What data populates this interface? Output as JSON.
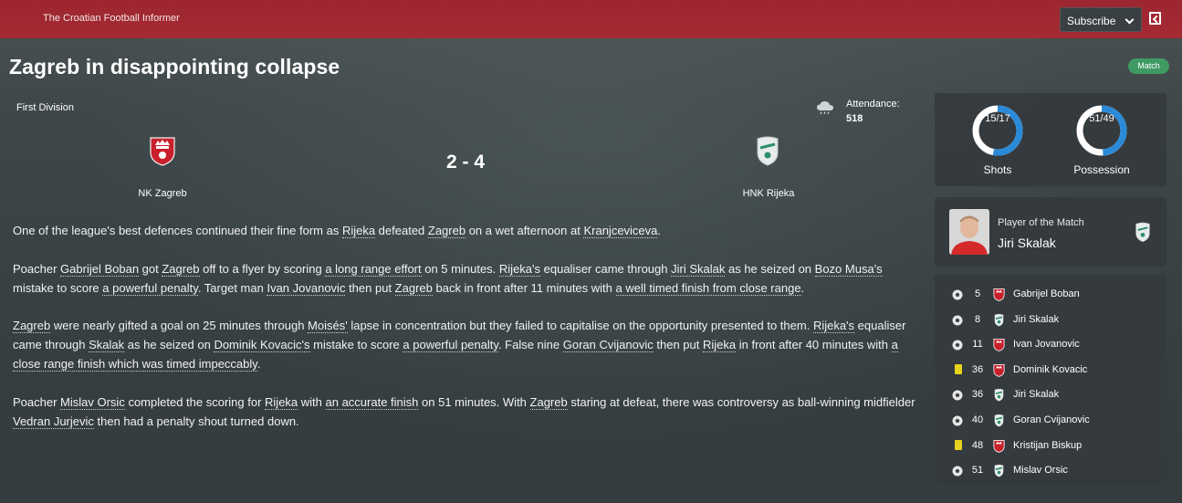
{
  "header": {
    "publication": "The Croatian Football Informer",
    "subscribe_label": "Subscribe"
  },
  "article": {
    "headline": "Zagreb in disappointing collapse",
    "tag": "Match",
    "competition": "First Division",
    "attendance_label": "Attendance:",
    "attendance": "518",
    "weather_icon": "rain-cloud-icon",
    "paragraphs": [
      [
        {
          "t": "One of the league's best defences continued their fine form as "
        },
        {
          "t": "Rijeka",
          "l": 1
        },
        {
          "t": " defeated "
        },
        {
          "t": "Zagreb",
          "l": 1
        },
        {
          "t": " on a wet afternoon at "
        },
        {
          "t": "Kranjceviceva",
          "l": 1
        },
        {
          "t": "."
        }
      ],
      [
        {
          "t": "Poacher "
        },
        {
          "t": "Gabrijel Boban",
          "l": 1
        },
        {
          "t": " got "
        },
        {
          "t": "Zagreb",
          "l": 1
        },
        {
          "t": " off to a flyer by scoring "
        },
        {
          "t": "a long range effort",
          "l": 1
        },
        {
          "t": " on 5 minutes. "
        },
        {
          "t": "Rijeka's",
          "l": 1
        },
        {
          "t": " equaliser came through "
        },
        {
          "t": "Jiri Skalak",
          "l": 1
        },
        {
          "t": " as he seized on "
        },
        {
          "t": "Bozo Musa's",
          "l": 1
        },
        {
          "t": " mistake to score "
        },
        {
          "t": "a powerful penalty",
          "l": 1
        },
        {
          "t": ". Target man "
        },
        {
          "t": "Ivan Jovanovic",
          "l": 1
        },
        {
          "t": " then put "
        },
        {
          "t": "Zagreb",
          "l": 1
        },
        {
          "t": " back in front after 11 minutes with "
        },
        {
          "t": "a well timed finish from close range",
          "l": 1
        },
        {
          "t": "."
        }
      ],
      [
        {
          "t": "Zagreb",
          "l": 1
        },
        {
          "t": " were nearly gifted a goal on 25 minutes through "
        },
        {
          "t": "Moisés'",
          "l": 1
        },
        {
          "t": " lapse in concentration but they failed to capitalise on the opportunity presented to them. "
        },
        {
          "t": "Rijeka's",
          "l": 1
        },
        {
          "t": " equaliser came through "
        },
        {
          "t": "Skalak",
          "l": 1
        },
        {
          "t": " as he seized on "
        },
        {
          "t": "Dominik Kovacic's",
          "l": 1
        },
        {
          "t": " mistake to score "
        },
        {
          "t": "a powerful penalty",
          "l": 1
        },
        {
          "t": ". False nine "
        },
        {
          "t": "Goran Cvijanovic",
          "l": 1
        },
        {
          "t": " then put "
        },
        {
          "t": "Rijeka",
          "l": 1
        },
        {
          "t": " in front after 40 minutes with "
        },
        {
          "t": "a close range finish which was timed impeccably",
          "l": 1
        },
        {
          "t": "."
        }
      ],
      [
        {
          "t": "Poacher "
        },
        {
          "t": "Mislav Orsic",
          "l": 1
        },
        {
          "t": " completed the scoring for "
        },
        {
          "t": "Rijeka",
          "l": 1
        },
        {
          "t": " with "
        },
        {
          "t": "an accurate finish",
          "l": 1
        },
        {
          "t": " on 51 minutes. With "
        },
        {
          "t": "Zagreb",
          "l": 1
        },
        {
          "t": " staring at defeat, there was controversy as ball-winning midfielder "
        },
        {
          "t": "Vedran Jurjevic",
          "l": 1
        },
        {
          "t": " then had a penalty shout turned down."
        }
      ]
    ]
  },
  "match": {
    "home_team": "NK Zagreb",
    "away_team": "HNK Rijeka",
    "score": "2 - 4",
    "home_color": "#c8202c",
    "away_color": "#2a8ad8"
  },
  "stats": {
    "shots": {
      "label": "Shots",
      "value": "15/17",
      "home_share": 0.47
    },
    "possession": {
      "label": "Possession",
      "value": "51/49",
      "home_share": 0.51
    }
  },
  "potm": {
    "label": "Player of the Match",
    "name": "Jiri Skalak"
  },
  "events": [
    {
      "minute": "5",
      "type": "goal",
      "team": "home",
      "player": "Gabrijel Boban"
    },
    {
      "minute": "8",
      "type": "goal",
      "team": "away",
      "player": "Jiri Skalak"
    },
    {
      "minute": "11",
      "type": "goal",
      "team": "home",
      "player": "Ivan Jovanovic"
    },
    {
      "minute": "36",
      "type": "yellow-card",
      "team": "home",
      "player": "Dominik Kovacic"
    },
    {
      "minute": "36",
      "type": "goal",
      "team": "away",
      "player": "Jiri Skalak"
    },
    {
      "minute": "40",
      "type": "goal",
      "team": "away",
      "player": "Goran Cvijanovic"
    },
    {
      "minute": "48",
      "type": "yellow-card",
      "team": "home",
      "player": "Kristijan Biskup"
    },
    {
      "minute": "51",
      "type": "goal",
      "team": "away",
      "player": "Mislav Orsic"
    }
  ]
}
